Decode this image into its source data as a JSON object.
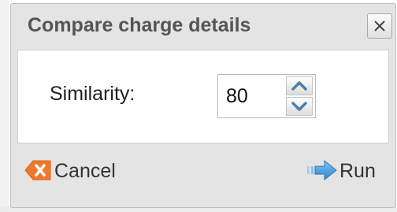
{
  "dialog": {
    "title": "Compare charge details",
    "close_icon": "close-icon"
  },
  "form": {
    "similarity_label": "Similarity:",
    "similarity_value": "80",
    "spin_up_icon": "spin-up-arrow-icon",
    "spin_down_icon": "spin-down-arrow-icon"
  },
  "footer": {
    "cancel_label": "Cancel",
    "cancel_icon": "cancel-x-icon",
    "run_label": "Run",
    "run_icon": "run-arrow-icon"
  },
  "colors": {
    "cancel_icon": "#f0782d",
    "run_icon": "#3e9bdc",
    "spin_arrows": "#4f7fa8"
  }
}
